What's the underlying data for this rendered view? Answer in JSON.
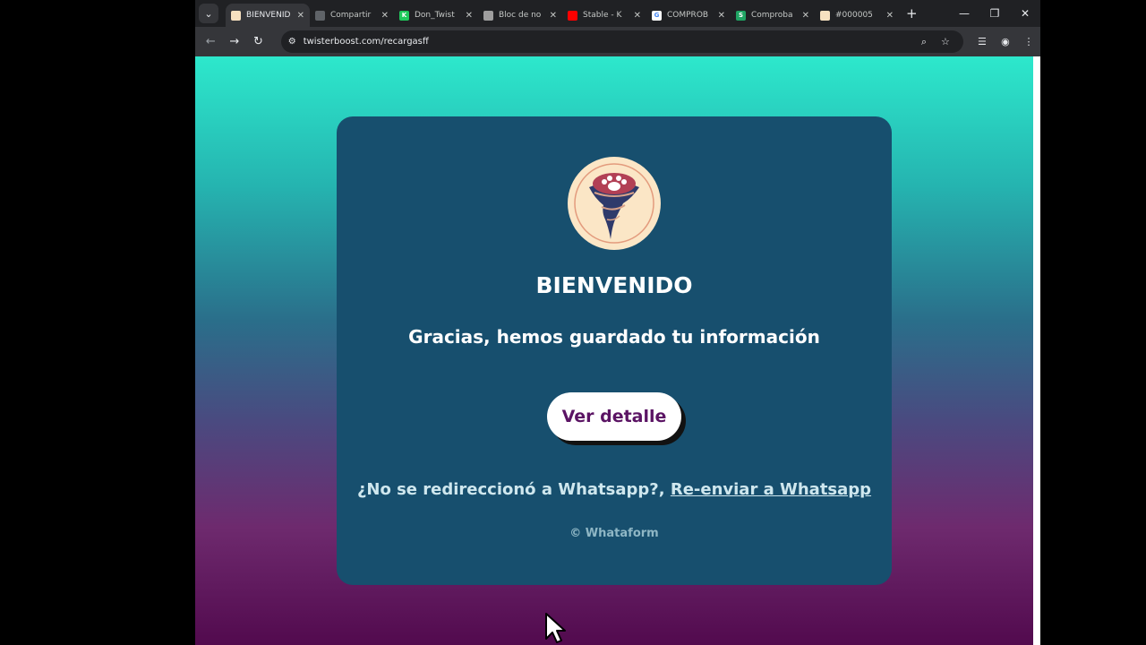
{
  "browser": {
    "tabs": [
      {
        "title": "BIENVENID",
        "active": true,
        "icon_color": "#f7e1c0"
      },
      {
        "title": "Compartir",
        "active": false,
        "icon_color": "#5f6368"
      },
      {
        "title": "Don_Twist",
        "active": false,
        "icon_color": "#20c95b",
        "icon_letter": "K"
      },
      {
        "title": "Bloc de no",
        "active": false,
        "icon_color": "#9e9e9e"
      },
      {
        "title": "Stable - K",
        "active": false,
        "icon_color": "#ff0000"
      },
      {
        "title": "COMPROB",
        "active": false,
        "icon_color": "#ffffff",
        "icon_letter": "G"
      },
      {
        "title": "Comproba",
        "active": false,
        "icon_color": "#1fa463",
        "icon_letter": "S"
      },
      {
        "title": "#000005",
        "active": false,
        "icon_color": "#f7e1c0"
      }
    ],
    "url": "twisterboost.com/recargasff"
  },
  "page": {
    "welcome_heading": "BIENVENIDO",
    "thanks_message": "Gracias, hemos guardado tu información",
    "detail_button_label": "Ver detalle",
    "redirect_question": "¿No se redireccionó a Whatsapp?,",
    "resend_link": "Re-enviar a Whatsapp",
    "copyright": "© Whataform"
  },
  "colors": {
    "card_bg": "#174f6e",
    "button_text": "#5b1464",
    "gradient_top": "#2de8cc",
    "gradient_bottom": "#520a4e"
  }
}
